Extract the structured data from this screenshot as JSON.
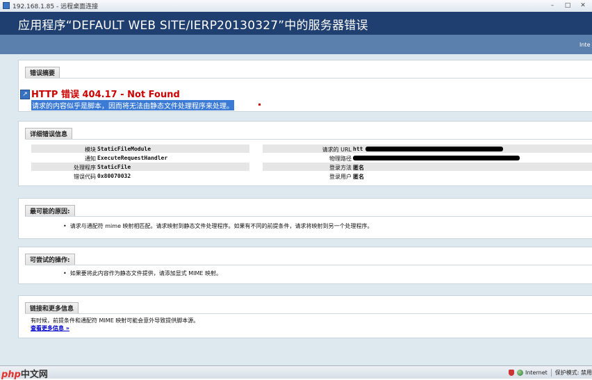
{
  "window": {
    "title": "192.168.1.85 - 远程桌面连接"
  },
  "header": {
    "title": "应用程序“DEFAULT WEB SITE/IERP20130327”中的服务器错误",
    "strip_text": "Inte"
  },
  "summary": {
    "legend": "错误摘要",
    "title": "HTTP 错误 404.17 - Not Found",
    "description": "请求的内容似乎是脚本，因而将无法由静态文件处理程序来处理。"
  },
  "detail": {
    "legend": "详细错误信息",
    "left": [
      {
        "label": "模块",
        "value": "StaticFileModule"
      },
      {
        "label": "通知",
        "value": "ExecuteRequestHandler"
      },
      {
        "label": "处理程序",
        "value": "StaticFile"
      },
      {
        "label": "错误代码",
        "value": "0x80070032"
      }
    ],
    "right": [
      {
        "label": "请求的 URL",
        "value": "htt"
      },
      {
        "label": "物理路径",
        "value": ""
      },
      {
        "label": "登录方法",
        "value": "匿名"
      },
      {
        "label": "登录用户",
        "value": "匿名"
      }
    ]
  },
  "causes": {
    "legend": "最可能的原因:",
    "items": [
      "请求与通配符 mime 映射相匹配。请求映射到静态文件处理程序。如果有不同的前提条件，请求将映射到另一个处理程序。"
    ]
  },
  "actions": {
    "legend": "可尝试的操作:",
    "items": [
      "如果要将此内容作为静态文件提供，请添加显式 MIME 映射。"
    ]
  },
  "links": {
    "legend": "链接和更多信息",
    "text": "有时候，前提条件和通配符 MIME 映射可能会意外导致提供脚本源。",
    "more": "查看更多信息 »"
  },
  "statusbar": {
    "watermark_php": "php",
    "watermark_zh": "中文网",
    "zone": "Internet",
    "protected": "保护模式: 禁用"
  }
}
